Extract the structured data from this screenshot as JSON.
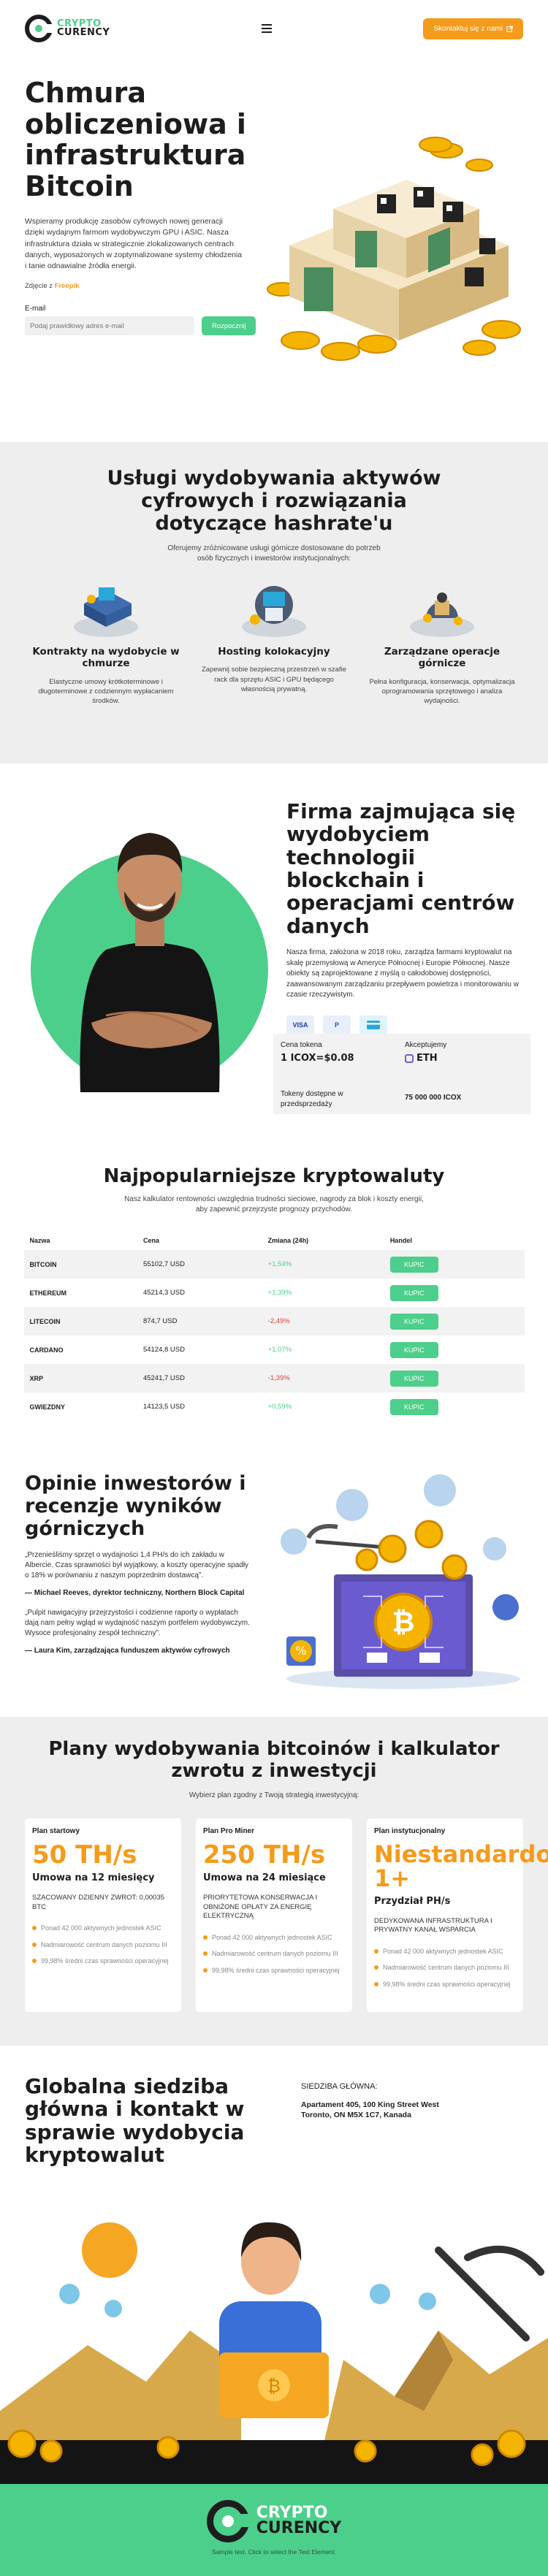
{
  "header": {
    "logo_line1": "CRYPTO",
    "logo_line2": "CURENCY",
    "menu_icon": "hamburger-icon",
    "cta_label": "Skontaktuj się z nami",
    "cta_icon": "external-link-icon"
  },
  "hero": {
    "title": "Chmura obliczeniowa i infrastruktura Bitcoin",
    "lead": "Wspieramy produkcję zasobów cyfrowych nowej generacji dzięki wydajnym farmom wydobywczym GPU i ASIC. Nasza infrastruktura działa w strategicznie zlokalizowanych centrach danych, wyposażonych w zoptymalizowane systemy chłodzenia i tanie odnawialne źródła energii.",
    "credit_prefix": "Zdjęcie z",
    "credit_source": "Freepik",
    "email_label": "E-mail",
    "email_placeholder": "Podaj prawidłowy adres e-mail",
    "submit_label": "Rozpocznij"
  },
  "services": {
    "title": "Usługi wydobywania aktywów cyfrowych i rozwiązania dotyczące hashrate'u",
    "subtitle": "Oferujemy zróżnicowane usługi górnicze dostosowane do potrzeb osób fizycznych i inwestorów instytucjonalnych:",
    "items": [
      {
        "title": "Kontrakty na wydobycie w chmurze",
        "text": "Elastyczne umowy krótkoterminowe i długoterminowe z codziennym wypłacaniem środków."
      },
      {
        "title": "Hosting kolokacyjny",
        "text": "Zapewnij sobie bezpieczną przestrzeń w szafie rack dla sprzętu ASIC i GPU będącego własnością prywatną."
      },
      {
        "title": "Zarządzane operacje górnicze",
        "text": "Pełna konfiguracja, konserwacja, optymalizacja oprogramowania sprzętowego i analiza wydajności."
      }
    ]
  },
  "about": {
    "title": "Firma zajmująca się wydobyciem technologii blockchain i operacjami centrów danych",
    "text": "Nasza firma, założona w 2018 roku, zarządza farmami kryptowalut na skalę przemysłową w Ameryce Północnej i Europie Północnej. Nasze obiekty są zaprojektowane z myślą o całodobowej dostępności, zaawansowanym zarządzaniu przepływem powietrza i monitorowaniu w czasie rzeczywistym.",
    "payments": [
      "VISA",
      "P",
      "card"
    ],
    "token_price_label": "Cena tokena",
    "token_price_value": "1 ICOX=$0.08",
    "accepted_label": "Akceptujemy",
    "accepted_value": "ETH",
    "presale_label": "Tokeny dostępne w przedsprzedaży",
    "presale_value": "75 000 000 ICOX"
  },
  "crypto": {
    "title": "Najpopularniejsze kryptowaluty",
    "subtitle": "Nasz kalkulator rentowności uwzględnia trudności sieciowe, nagrody za blok i koszty energii, aby zapewnić przejrzyste prognozy przychodów.",
    "headers": [
      "Nazwa",
      "Cena",
      "Zmiana (24h)",
      "Handel"
    ],
    "rows": [
      {
        "name": "BITCOIN",
        "price": "55102,7 USD",
        "change": "+1,54%",
        "trend": "up",
        "action": "KUPIC"
      },
      {
        "name": "ETHEREUM",
        "price": "45214,3 USD",
        "change": "+1,39%",
        "trend": "up",
        "action": "KUPIC"
      },
      {
        "name": "LITECOIN",
        "price": "874,7 USD",
        "change": "-2,49%",
        "trend": "down",
        "action": "KUPIC"
      },
      {
        "name": "CARDANO",
        "price": "54124,8 USD",
        "change": "+1,07%",
        "trend": "up",
        "action": "KUPIC"
      },
      {
        "name": "XRP",
        "price": "45241,7 USD",
        "change": "-1,39%",
        "trend": "down",
        "action": "KUPIC"
      },
      {
        "name": "GWIEZDNY",
        "price": "14123,5 USD",
        "change": "+0,59%",
        "trend": "up",
        "action": "KUPIC"
      }
    ]
  },
  "reviews": {
    "title": "Opinie inwestorów i recenzje wyników górniczych",
    "items": [
      {
        "quote": "„Przenieśliśmy sprzęt o wydajności 1,4 PH/s do ich zakładu w Albercie. Czas sprawności był wyjątkowy, a koszty operacyjne spadły o 18% w porównaniu z naszym poprzednim dostawcą”.",
        "author": "— Michael Reeves, dyrektor techniczny, Northern Block Capital"
      },
      {
        "quote": "„Pulpit nawigacyjny przejrzystości i codzienne raporty o wypłatach dają nam pełny wgląd w wydajność naszym portfelem wydobywczym. Wysoce profesjonalny zespół techniczny”.",
        "author": "— Laura Kim, zarządzająca funduszem aktywów cyfrowych"
      }
    ]
  },
  "plans": {
    "title": "Plany wydobywania bitcoinów i kalkulator zwrotu z inwestycji",
    "subtitle": "Wybierz plan zgodny z Twoją strategią inwestycyjną:",
    "items": [
      {
        "name": "Plan startowy",
        "big": "50 TH/s",
        "terms": "Umowa na 12 miesięcy",
        "desc": "SZACOWANY DZIENNY ZWROT: 0,00035 BTC",
        "features": [
          "Ponad 42 000 aktywnych jednostek ASIC",
          "Nadmiarowość centrum danych poziomu III",
          "99,98% średni czas sprawności operacyjnej"
        ]
      },
      {
        "name": "Plan Pro Miner",
        "big": "250 TH/s",
        "terms": "Umowa na 24 miesiące",
        "desc": "PRIORYTETOWA KONSERWACJA I OBNIŻONE OPŁATY ZA ENERGIĘ ELEKTRYCZNĄ",
        "features": [
          "Ponad 42 000 aktywnych jednostek ASIC",
          "Nadmiarowość centrum danych poziomu III",
          "99,98% średni czas sprawności operacyjnej"
        ]
      },
      {
        "name": "Plan instytucjonalny",
        "big": "Niestandardo 1+",
        "terms": "Przydział PH/s",
        "desc": "DEDYKOWANA INFRASTRUKTURA I PRYWATNY KANAŁ WSPARCIA",
        "features": [
          "Ponad 42 000 aktywnych jednostek ASIC",
          "Nadmiarowość centrum danych poziomu III",
          "99,98% średni czas sprawności operacyjnej"
        ]
      }
    ]
  },
  "contact": {
    "title": "Globalna siedziba główna i kontakt w sprawie wydobycia kryptowalut",
    "hq_label": "SIEDZIBA GŁÓWNA:",
    "address": "Apartament 405, 100 King Street West Toronto, ON M5X 1C7, Kanada"
  },
  "footer": {
    "logo_line1": "CRYPTO",
    "logo_line2": "CURENCY",
    "copyright": "Sample text. Click to select the Text Element."
  },
  "colors": {
    "accent_green": "#4ccf8a",
    "accent_orange": "#f59b1b",
    "text_dark": "#1d1d1f",
    "panel_gray": "#eeeeee",
    "negative_red": "#e23c3c"
  }
}
